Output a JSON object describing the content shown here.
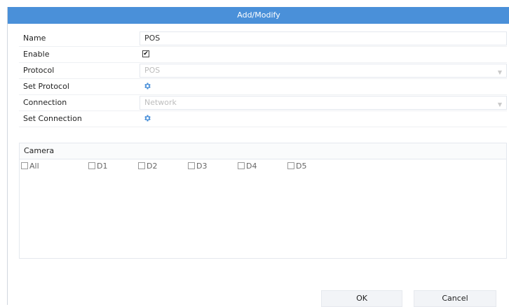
{
  "dialog": {
    "title": "Add/Modify"
  },
  "form": {
    "name": {
      "label": "Name",
      "value": "POS"
    },
    "enable": {
      "label": "Enable",
      "checked": true
    },
    "protocol": {
      "label": "Protocol",
      "value": "POS",
      "disabled": true
    },
    "set_protocol": {
      "label": "Set Protocol",
      "icon": "gear-icon"
    },
    "connection": {
      "label": "Connection",
      "value": "Network",
      "disabled": true
    },
    "set_connection": {
      "label": "Set Connection",
      "icon": "gear-icon"
    }
  },
  "camera": {
    "label": "Camera",
    "items": [
      {
        "label": "All",
        "checked": false
      },
      {
        "label": "D1",
        "checked": false
      },
      {
        "label": "D2",
        "checked": false
      },
      {
        "label": "D3",
        "checked": false
      },
      {
        "label": "D4",
        "checked": false
      },
      {
        "label": "D5",
        "checked": false
      }
    ]
  },
  "buttons": {
    "ok": "OK",
    "cancel": "Cancel"
  },
  "colors": {
    "titlebar": "#4a90d9",
    "gear": "#4a90d9",
    "button_bg": "#f2f4f7"
  }
}
